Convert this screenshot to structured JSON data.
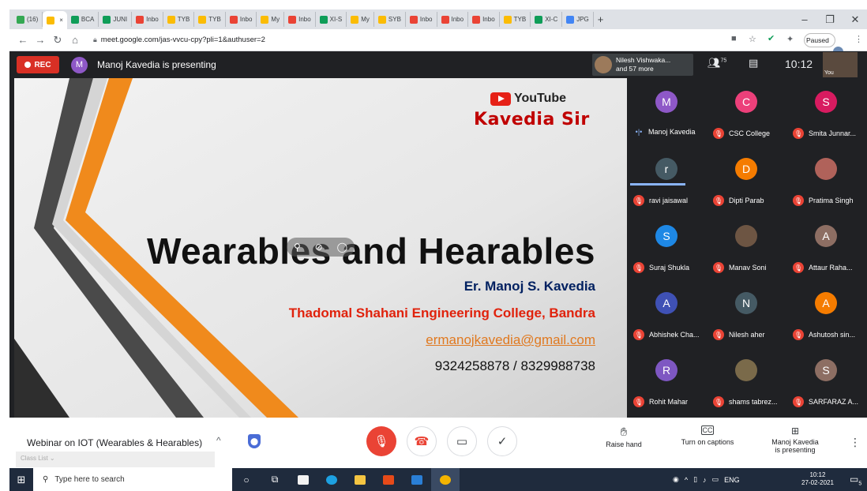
{
  "browser": {
    "tabs": [
      {
        "label": "(16)",
        "color": "#34a853"
      },
      {
        "label": "",
        "color": "#fbbc04",
        "active": true
      },
      {
        "label": "BCA",
        "color": "#0f9d58"
      },
      {
        "label": "JUNI",
        "color": "#0f9d58"
      },
      {
        "label": "Inbo",
        "color": "#ea4335"
      },
      {
        "label": "TYB",
        "color": "#fbbc04"
      },
      {
        "label": "TYB",
        "color": "#fbbc04"
      },
      {
        "label": "Inbo",
        "color": "#ea4335"
      },
      {
        "label": "My",
        "color": "#fbbc04"
      },
      {
        "label": "Inbo",
        "color": "#ea4335"
      },
      {
        "label": "XI-S",
        "color": "#0f9d58"
      },
      {
        "label": "My",
        "color": "#fbbc04"
      },
      {
        "label": "SYB",
        "color": "#fbbc04"
      },
      {
        "label": "Inbo",
        "color": "#ea4335"
      },
      {
        "label": "Inbo",
        "color": "#ea4335"
      },
      {
        "label": "Inbo",
        "color": "#ea4335"
      },
      {
        "label": "TYB",
        "color": "#fbbc04"
      },
      {
        "label": "XI-C",
        "color": "#0f9d58"
      },
      {
        "label": "JPG",
        "color": "#4285f4"
      }
    ],
    "new_tab": "+",
    "minimize": "–",
    "restore": "❐",
    "close": "✕",
    "url": "meet.google.com/jas-vvcu-cpy?pli=1&authuser=2",
    "profile_status": "Paused"
  },
  "meet": {
    "rec_label": "REC",
    "presenter_initial": "M",
    "presenting_text": "Manoj Kavedia is presenting",
    "viewers_line1": "Nilesh Vishwaka...",
    "viewers_line2": "and 57 more",
    "participant_count": "75",
    "clock": "10:12",
    "self_label": "You",
    "slide": {
      "youtube_label": "YouTube",
      "channel_first": "K",
      "channel_rest": "avedia Sir",
      "title": "Wearables and Hearables",
      "author": "Er. Manoj S. Kavedia",
      "college": "Thadomal Shahani Engineering College, Bandra",
      "email": "ermanojkavedia@gmail.com",
      "phone": "9324258878 / 8329988738"
    },
    "participants": [
      {
        "name": "Manoj Kavedia",
        "initial": "M",
        "color": "#8e58c7",
        "speaking": true
      },
      {
        "name": "CSC College",
        "initial": "C",
        "color": "#ec407a"
      },
      {
        "name": "Smita Junnar...",
        "initial": "S",
        "color": "#d81b60"
      },
      {
        "name": "ravi jaisawal",
        "initial": "r",
        "color": "#455a64"
      },
      {
        "name": "Dipti Parab",
        "initial": "D",
        "color": "#f57c00"
      },
      {
        "name": "Pratima Singh",
        "initial": "",
        "color": "#b0625a"
      },
      {
        "name": "Suraj Shukla",
        "initial": "S",
        "color": "#1e88e5"
      },
      {
        "name": "Manav Soni",
        "initial": "",
        "color": "#6d5543"
      },
      {
        "name": "Attaur Raha...",
        "initial": "A",
        "color": "#8d6e63"
      },
      {
        "name": "Abhishek Cha...",
        "initial": "A",
        "color": "#3f51b5"
      },
      {
        "name": "Nilesh aher",
        "initial": "N",
        "color": "#455a64"
      },
      {
        "name": "Ashutosh sin...",
        "initial": "A",
        "color": "#f57c00"
      },
      {
        "name": "Rohit Mahar",
        "initial": "R",
        "color": "#7e57c2"
      },
      {
        "name": "shams tabrez...",
        "initial": "",
        "color": "#7a6a4a"
      },
      {
        "name": "SARFARAZ A...",
        "initial": "S",
        "color": "#8d6e63"
      }
    ],
    "meeting_title": "Webinar on IOT (Wearables & Hearables)",
    "class_list": "Class List",
    "raise_hand": "Raise hand",
    "captions": "Turn on captions",
    "presenting_line1": "Manoj Kavedia",
    "presenting_line2": "is presenting"
  },
  "taskbar": {
    "search_placeholder": "Type here to search",
    "lang": "ENG",
    "time": "10:12",
    "date": "27-02-2021",
    "notifications": "5"
  }
}
